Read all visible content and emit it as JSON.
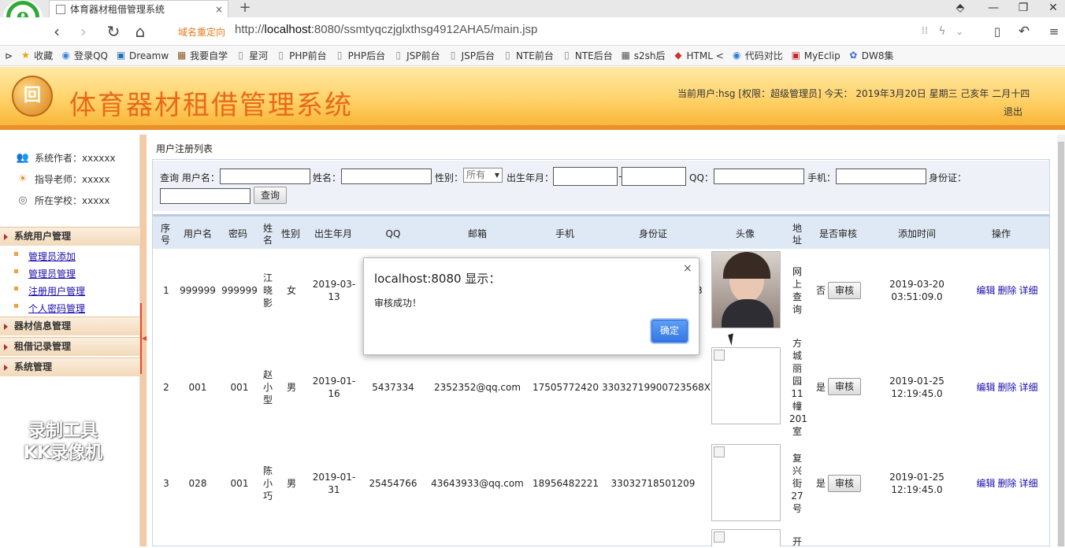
{
  "browser": {
    "tab_title": "体育器材租借管理系统",
    "tab_close": "×",
    "new_tab": "+",
    "redirect_label": "域名重定向",
    "url_prefix": "http://",
    "url_host": "localhost",
    "url_rest": ":8080/ssmtyqczjglxthsg4912AHA5/main.jsp",
    "bookmarks": [
      "收藏",
      "登录QQ",
      "Dreamw",
      "我要自学",
      "星河",
      "PHP前台",
      "PHP后台",
      "JSP前台",
      "JSP后台",
      "NTE前台",
      "NTE后台",
      "s2sh后",
      "HTML <",
      "代码对比",
      "MyEclip",
      "DW8集"
    ]
  },
  "app": {
    "logo_text": "回",
    "title": "体育器材租借管理系统",
    "user_info": "当前用户:hsg [权限：超级管理员] 今天： 2019年3月20日 星期三 己亥年 二月十四",
    "logout": "退出"
  },
  "sidebar": {
    "info": [
      {
        "label": "系统作者：xxxxxx"
      },
      {
        "label": "指导老师：xxxxx"
      },
      {
        "label": "所在学校：xxxxx"
      }
    ],
    "menus": [
      {
        "title": "系统用户管理",
        "items": [
          "管理员添加",
          "管理员管理",
          "注册用户管理",
          "个人密码管理"
        ]
      },
      {
        "title": "器材信息管理",
        "items": []
      },
      {
        "title": "租借记录管理",
        "items": []
      },
      {
        "title": "系统管理",
        "items": []
      }
    ],
    "watermark_line1": "录制工具",
    "watermark_line2": "KK录像机"
  },
  "list": {
    "title": "用户注册列表",
    "search": {
      "query_label": "查询 用户名：",
      "name_label": "姓名：",
      "gender_label": "性别：",
      "gender_value": "所有",
      "birth_label": "出生年月：",
      "birth_sep": "-",
      "qq_label": "QQ：",
      "phone_label": "手机：",
      "id_label": "身份证：",
      "button": "查询"
    },
    "columns": [
      "序号",
      "用户名",
      "密码",
      "姓名",
      "性别",
      "出生年月",
      "QQ",
      "邮箱",
      "手机",
      "身份证",
      "头像",
      "地址",
      "是否审核",
      "添加时间",
      "操作"
    ],
    "rows": [
      {
        "no": "1",
        "username": "999999",
        "password": "999999",
        "name": "江晓影",
        "gender": "女",
        "birth_a": "2019-03-",
        "birth_b": "13",
        "qq": "",
        "email": "",
        "phone": "",
        "idcard": "3",
        "address": "网上查询",
        "audited": "否",
        "audit_btn": "审核",
        "time_a": "2019-03-20",
        "time_b": "03:51:09.0"
      },
      {
        "no": "2",
        "username": "001",
        "password": "001",
        "name": "赵小型",
        "gender": "男",
        "birth_a": "2019-01-",
        "birth_b": "16",
        "qq": "5437334",
        "email": "2352352@qq.com",
        "phone": "17505772420",
        "idcard": "33032719900723568X",
        "address": "方城丽园11幢201室",
        "audited": "是",
        "audit_btn": "审核",
        "time_a": "2019-01-25",
        "time_b": "12:19:45.0"
      },
      {
        "no": "3",
        "username": "028",
        "password": "001",
        "name": "陈小巧",
        "gender": "男",
        "birth_a": "2019-01-",
        "birth_b": "31",
        "qq": "25454766",
        "email": "43643933@qq.com",
        "phone": "18956482221",
        "idcard": "33032718501209",
        "address": "复兴街27号",
        "audited": "是",
        "audit_btn": "审核",
        "time_a": "2019-01-25",
        "time_b": "12:19:45.0"
      }
    ],
    "ops": [
      "编辑",
      "删除",
      "详细"
    ],
    "row4_address": "开"
  },
  "dialog": {
    "title": "localhost:8080 显示：",
    "message": "审核成功！",
    "ok": "确定",
    "close": "×"
  }
}
